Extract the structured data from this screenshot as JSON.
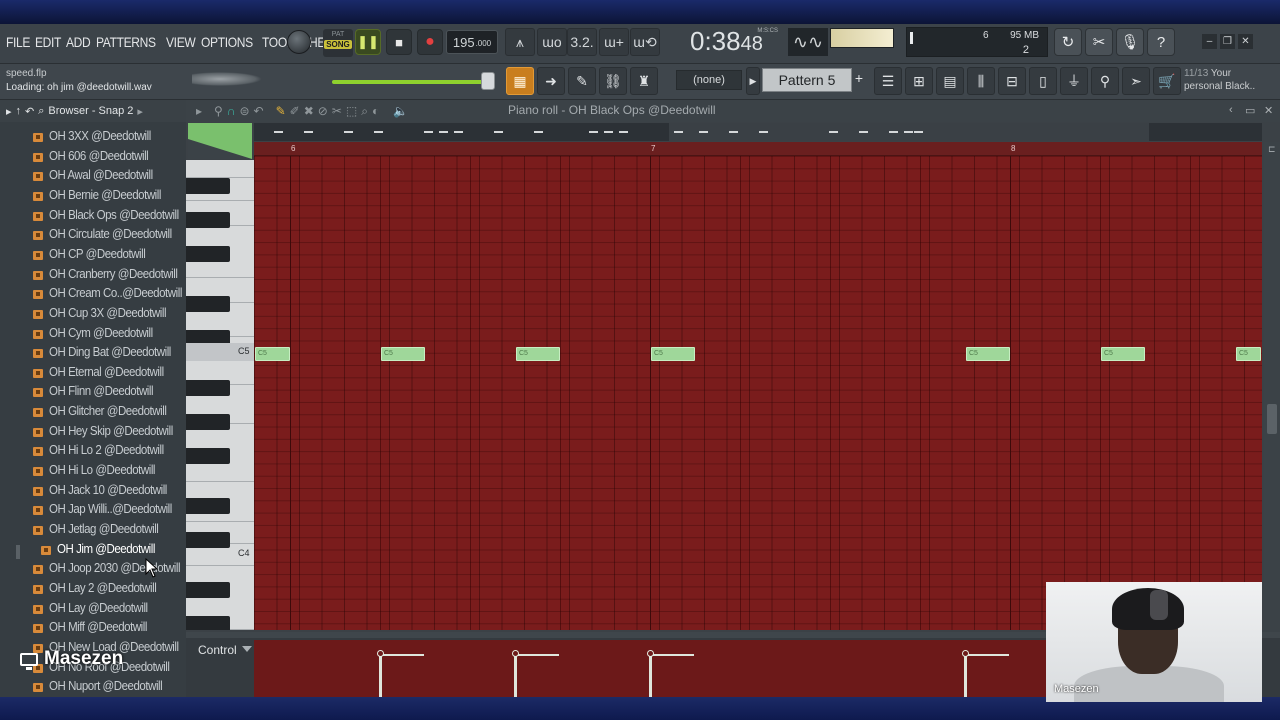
{
  "menu": [
    "FILE",
    "EDIT",
    "ADD",
    "PATTERNS",
    "VIEW",
    "OPTIONS",
    "TOOLS",
    "HELP"
  ],
  "transport": {
    "pat_label": "PAT",
    "song_label": "SONG",
    "tempo": "195",
    "tempo_decimal": ".000",
    "time": "0:38",
    "time_frac": "48",
    "time_unit": "M:S:CS"
  },
  "memory": {
    "cpu": "6",
    "ram": "95 MB",
    "poly": "2"
  },
  "hint_bar": {
    "line1": "speed.flp",
    "line2": "Loading: oh jim @deedotwill.wav"
  },
  "toolbar2": {
    "snap_none": "(none)",
    "pattern": "Pattern 5",
    "hint_num": "11/13",
    "hint_text_1": "Your",
    "hint_text_2": "personal Black.."
  },
  "browser": {
    "title": "Browser - Snap 2",
    "items": [
      "OH 3XX @Deedotwill",
      "OH 606 @Deedotwill",
      "OH Awal @Deedotwill",
      "OH Bernie @Deedotwill",
      "OH Black Ops @Deedotwill",
      "OH Circulate @Deedotwill",
      "OH CP @Deedotwill",
      "OH Cranberry @Deedotwill",
      "OH Cream Co..@Deedotwill",
      "OH Cup 3X @Deedotwill",
      "OH Cym @Deedotwill",
      "OH Ding Bat @Deedotwill",
      "OH Eternal @Deedotwill",
      "OH Flinn @Deedotwill",
      "OH Glitcher @Deedotwill",
      "OH Hey Skip @Deedotwill",
      "OH Hi Lo 2 @Deedotwill",
      "OH Hi Lo @Deedotwill",
      "OH Jack 10 @Deedotwill",
      "OH Jap Willi..@Deedotwill",
      "OH Jetlag @Deedotwill",
      "OH Jim @Deedotwill",
      "OH Joop 2030 @Deedotwill",
      "OH Lay 2 @Deedotwill",
      "OH Lay @Deedotwill",
      "OH Miff @Deedotwill",
      "OH New Load @Deedotwill",
      "OH No Roof @Deedotwill",
      "OH Nuport @Deedotwill"
    ],
    "selected_index": 21
  },
  "piano_roll": {
    "title": "Piano roll - OH Black Ops @Deedotwill",
    "bar_numbers": [
      "6",
      "7",
      "8"
    ],
    "key_labels": {
      "c5": "C5",
      "c4": "C4"
    },
    "note_label": "C5",
    "control_label": "Control",
    "note_color": "#9fd79a",
    "grid_color": "#7a1c1c"
  },
  "webcam": {
    "name": "Masezen"
  },
  "overlay": {
    "name": "Masezen"
  }
}
